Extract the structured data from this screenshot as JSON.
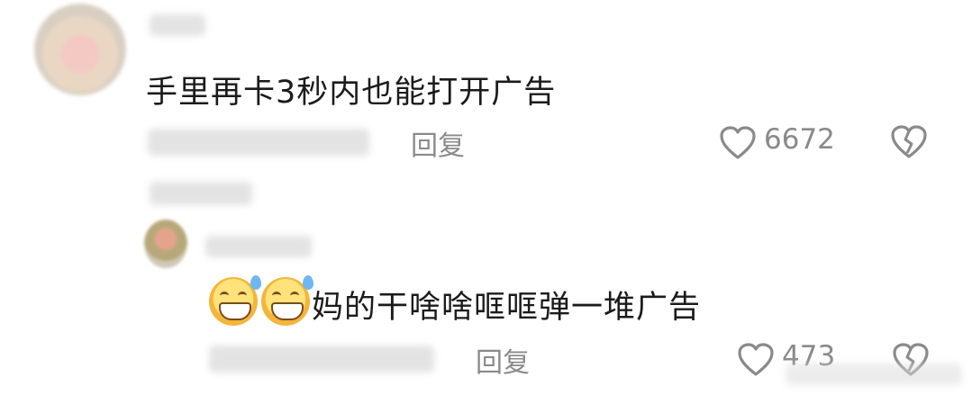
{
  "comment1": {
    "text": "手里再卡3秒内也能打开广告",
    "reply_label": "回复",
    "like_count": "6672"
  },
  "reply1": {
    "text": "妈的干啥啥哐哐弹一堆广告",
    "reply_label": "回复",
    "like_count": "473"
  },
  "icons": {
    "like": "heart-outline-icon",
    "dislike": "broken-heart-icon",
    "reply_emoji": "sweat-grin-emoji"
  }
}
